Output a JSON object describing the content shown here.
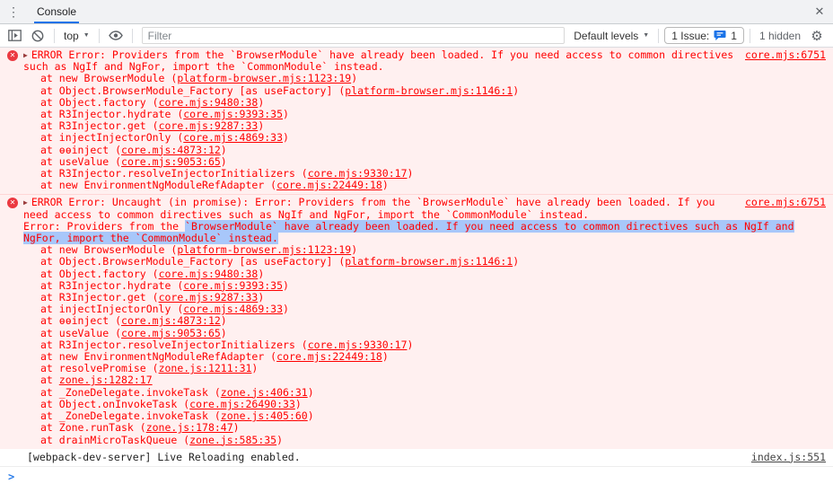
{
  "icons": {
    "kebab": "⋮",
    "close": "✕",
    "caret_down": "▼",
    "gear": "⚙",
    "expand_triangle": "▶",
    "error_x": "✕",
    "prompt_chevron": ">"
  },
  "tabbar": {
    "tab_label": "Console"
  },
  "toolbar": {
    "context_selector": "top",
    "filter_placeholder": "Filter",
    "levels_selector": "Default levels",
    "issues": {
      "label": "1 Issue:",
      "count": "1"
    },
    "hidden_count": "1 hidden"
  },
  "console": {
    "messages": [
      {
        "type": "error",
        "source_link": "core.mjs:6751",
        "text": "ERROR Error: Providers from the `BrowserModule` have already been loaded. If you need access to common directives such as NgIf and NgFor, import the `CommonModule` instead.",
        "stack": [
          {
            "pre": "at new BrowserModule (",
            "link": "platform-browser.mjs:1123:19",
            "post": ")"
          },
          {
            "pre": "at Object.BrowserModule_Factory [as useFactory] (",
            "link": "platform-browser.mjs:1146:1",
            "post": ")"
          },
          {
            "pre": "at Object.factory (",
            "link": "core.mjs:9480:38",
            "post": ")"
          },
          {
            "pre": "at R3Injector.hydrate (",
            "link": "core.mjs:9393:35",
            "post": ")"
          },
          {
            "pre": "at R3Injector.get (",
            "link": "core.mjs:9287:33",
            "post": ")"
          },
          {
            "pre": "at injectInjectorOnly (",
            "link": "core.mjs:4869:33",
            "post": ")"
          },
          {
            "pre": "at ɵɵinject (",
            "link": "core.mjs:4873:12",
            "post": ")"
          },
          {
            "pre": "at useValue (",
            "link": "core.mjs:9053:65",
            "post": ")"
          },
          {
            "pre": "at R3Injector.resolveInjectorInitializers (",
            "link": "core.mjs:9330:17",
            "post": ")"
          },
          {
            "pre": "at new EnvironmentNgModuleRefAdapter (",
            "link": "core.mjs:22449:18",
            "post": ")"
          }
        ]
      },
      {
        "type": "error",
        "source_link": "core.mjs:6751",
        "text": "ERROR Error: Uncaught (in promise): Error: Providers from the `BrowserModule` have already been loaded. If you need access to common directives such as NgIf and NgFor, import the `CommonModule` instead.",
        "detail_plain": "Error: Providers from the ",
        "detail_selected": "`BrowserModule` have already been loaded. If you need access to common directives such as NgIf and NgFor, import the `CommonModule` instead.",
        "stack": [
          {
            "pre": "at new BrowserModule (",
            "link": "platform-browser.mjs:1123:19",
            "post": ")"
          },
          {
            "pre": "at Object.BrowserModule_Factory [as useFactory] (",
            "link": "platform-browser.mjs:1146:1",
            "post": ")"
          },
          {
            "pre": "at Object.factory (",
            "link": "core.mjs:9480:38",
            "post": ")"
          },
          {
            "pre": "at R3Injector.hydrate (",
            "link": "core.mjs:9393:35",
            "post": ")"
          },
          {
            "pre": "at R3Injector.get (",
            "link": "core.mjs:9287:33",
            "post": ")"
          },
          {
            "pre": "at injectInjectorOnly (",
            "link": "core.mjs:4869:33",
            "post": ")"
          },
          {
            "pre": "at ɵɵinject (",
            "link": "core.mjs:4873:12",
            "post": ")"
          },
          {
            "pre": "at useValue (",
            "link": "core.mjs:9053:65",
            "post": ")"
          },
          {
            "pre": "at R3Injector.resolveInjectorInitializers (",
            "link": "core.mjs:9330:17",
            "post": ")"
          },
          {
            "pre": "at new EnvironmentNgModuleRefAdapter (",
            "link": "core.mjs:22449:18",
            "post": ")"
          },
          {
            "pre": "at resolvePromise (",
            "link": "zone.js:1211:31",
            "post": ")"
          },
          {
            "pre": "at ",
            "link": "zone.js:1282:17",
            "post": ""
          },
          {
            "pre": "at _ZoneDelegate.invokeTask (",
            "link": "zone.js:406:31",
            "post": ")"
          },
          {
            "pre": "at Object.onInvokeTask (",
            "link": "core.mjs:26490:33",
            "post": ")"
          },
          {
            "pre": "at _ZoneDelegate.invokeTask (",
            "link": "zone.js:405:60",
            "post": ")"
          },
          {
            "pre": "at Zone.runTask (",
            "link": "zone.js:178:47",
            "post": ")"
          },
          {
            "pre": "at drainMicroTaskQueue (",
            "link": "zone.js:585:35",
            "post": ")"
          }
        ]
      },
      {
        "type": "info",
        "source_link": "index.js:551",
        "text": "[webpack-dev-server] Live Reloading enabled."
      }
    ]
  }
}
